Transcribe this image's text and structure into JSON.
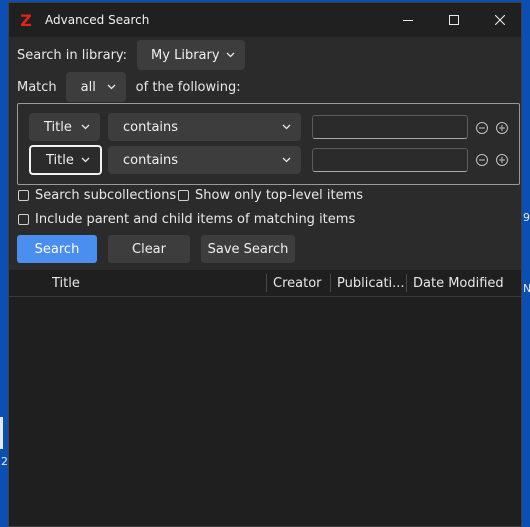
{
  "window": {
    "title": "Advanced Search",
    "logo_letter": "Z",
    "controls": [
      "minimize",
      "maximize",
      "close"
    ]
  },
  "search_in": {
    "label": "Search in library:",
    "value": "My Library"
  },
  "match": {
    "label": "Match",
    "value": "all",
    "suffix": "of the following:"
  },
  "conditions": [
    {
      "field": "Title",
      "operator": "contains",
      "value": ""
    },
    {
      "field": "Title",
      "operator": "contains",
      "value": ""
    }
  ],
  "options": {
    "subcollections": "Search subcollections",
    "top_level": "Show only top-level items",
    "parent_child": "Include parent and child items of matching items"
  },
  "buttons": {
    "search": "Search",
    "clear": "Clear",
    "save": "Save Search"
  },
  "results": {
    "columns": [
      "Title",
      "Creator",
      "Publicati...",
      "Date Modified"
    ]
  },
  "desktop": {
    "right_glyph_1": "9",
    "right_glyph_2": "N",
    "left_glyph": "2"
  },
  "colors": {
    "primary_button": "#4a8ef0",
    "logo": "#e2231a",
    "desktop": "#0c4fb3"
  }
}
